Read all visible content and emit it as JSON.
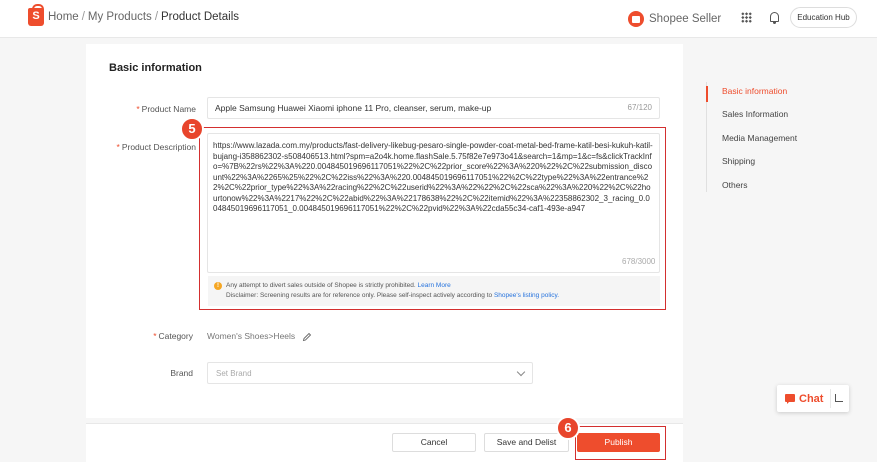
{
  "header": {
    "breadcrumb": [
      "Home",
      "My Products",
      "Product Details"
    ],
    "separator": "/",
    "logo_letter": "S",
    "brand": "Shopee Seller",
    "education_hub": "Education Hub"
  },
  "form": {
    "section_title": "Basic information",
    "required_mark": "*",
    "product_name": {
      "label": "Product Name",
      "value": "Apple Samsung Huawei Xiaomi iphone 11 Pro, cleanser, serum, make-up",
      "counter": "67/120"
    },
    "description": {
      "label": "Product Description",
      "value": "https://www.lazada.com.my/products/fast-delivery-likebug-pesaro-single-powder-coat-metal-bed-frame-katil-besi-kukuh-katil-bujang-i358862302-s508406513.html?spm=a2o4k.home.flashSale.5.75f82e7e973o41&search=1&mp=1&c=fs&clickTrackInfo=%7B%22rs%22%3A%220.004845019696117051%22%2C%22prior_score%22%3A%220%22%2C%22submission_discount%22%3A%2265%25%22%2C%22iss%22%3A%220.004845019696117051%22%2C%22type%22%3A%22entrance%22%2C%22prior_type%22%3A%22racing%22%2C%22userid%22%3A%22%22%2C%22sca%22%3A%220%22%2C%22hourtonow%22%3A%2217%22%2C%22abid%22%3A%22178638%22%2C%22itemid%22%3A%22358862302_3_racing_0.004845019696117051_0.004845019696117051%22%2C%22pvid%22%3A%22cda55c34-caf1-493e-a947",
      "counter": "678/3000",
      "notice_line1": "Any attempt to divert sales outside of Shopee is strictly prohibited.",
      "notice_link1": "Learn More",
      "notice_line2": "Disclaimer: Screening results are for reference only. Please self-inspect actively according to",
      "notice_link2": "Shopee's listing policy.",
      "warn_glyph": "!"
    },
    "category": {
      "label": "Category",
      "value": "Women's Shoes>Heels"
    },
    "brand": {
      "label": "Brand",
      "placeholder": "Set Brand"
    }
  },
  "footer": {
    "cancel": "Cancel",
    "save_delist": "Save and Delist",
    "publish": "Publish"
  },
  "side_nav": {
    "items": [
      "Basic information",
      "Sales Information",
      "Media Management",
      "Shipping",
      "Others"
    ],
    "active": "Basic information"
  },
  "chat": {
    "label": "Chat"
  },
  "annotations": {
    "step_desc": "5",
    "step_publish": "6"
  },
  "colors": {
    "accent": "#ee4d2d",
    "annotation": "#d32f2f",
    "link": "#2673dd"
  }
}
